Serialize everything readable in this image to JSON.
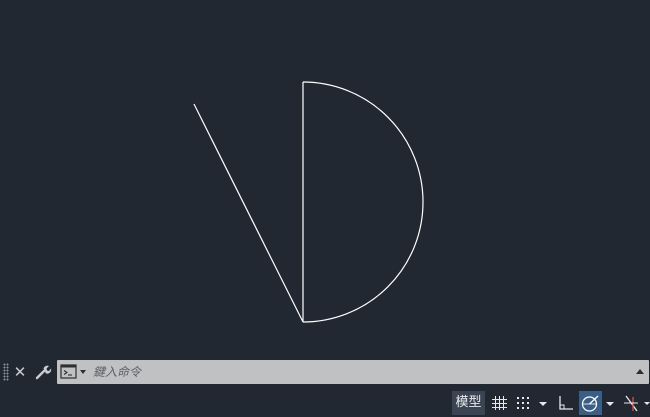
{
  "command_line": {
    "placeholder": "鍵入命令",
    "close_icon": "close-icon",
    "customize_icon": "wrench-icon",
    "prompt_icon": "command-prompt-icon",
    "history_icon": "chevron-up-icon"
  },
  "status_bar": {
    "model_label": "模型",
    "buttons": [
      "grid-icon",
      "snap-icon",
      "snap-mode-dropdown-icon",
      "ortho-icon",
      "polar-tracking-icon",
      "polar-dropdown-icon",
      "isometric-icon"
    ]
  },
  "colors": {
    "background": "#212832",
    "geometry": "#ffffff",
    "command_box": "#bfc1c3",
    "active_button": "#3a5f86"
  }
}
